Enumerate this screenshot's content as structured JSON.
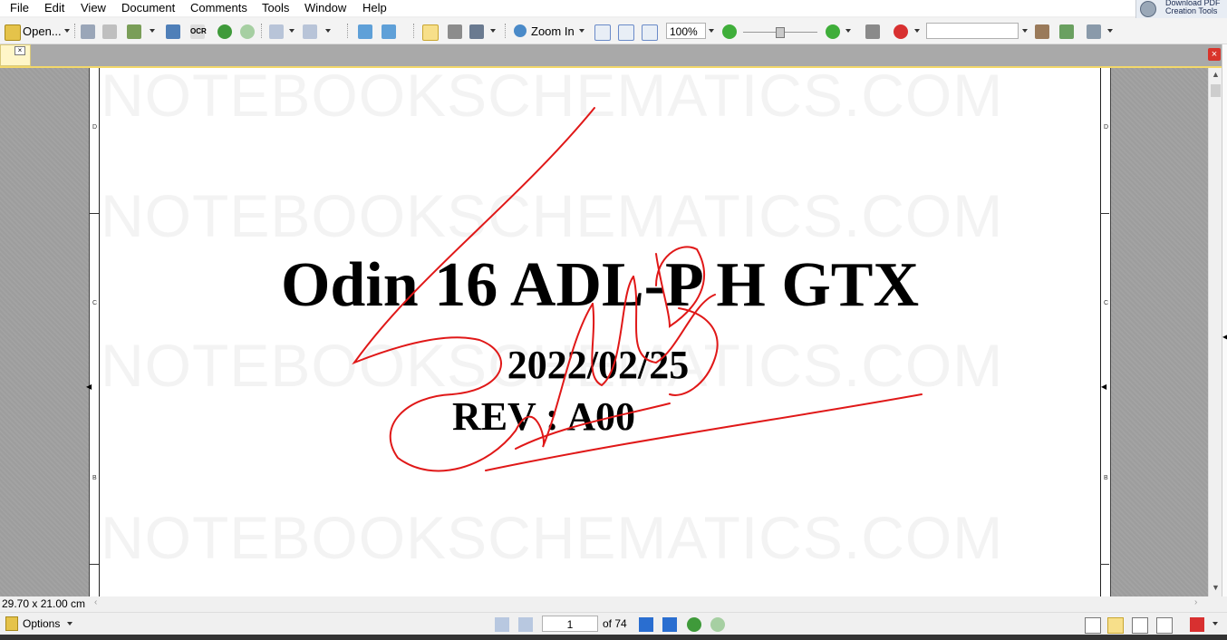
{
  "menu": [
    "File",
    "Edit",
    "View",
    "Document",
    "Comments",
    "Tools",
    "Window",
    "Help"
  ],
  "download": {
    "line1": "Download PDF",
    "line2": "Creation Tools"
  },
  "toolbar": {
    "open_label": "Open...",
    "ocr_label": "OCR",
    "zoom_in_label": "Zoom In",
    "zoom_value": "100%",
    "search_value": ""
  },
  "document": {
    "title": "Odin 16 ADL-P H GTX",
    "date": "2022/02/25",
    "revision": "REV : A00",
    "watermark": "NOTEBOOKSCHEMATICS.COM",
    "zones": [
      "D",
      "C",
      "B"
    ]
  },
  "status": {
    "page_size": "29.70 x 21.00 cm"
  },
  "nav": {
    "options_label": "Options",
    "current_page": "1",
    "page_count": "of 74"
  },
  "colors": {
    "signature": "#e01818",
    "tab": "#fff6c8",
    "accent": "#f3d86a"
  }
}
